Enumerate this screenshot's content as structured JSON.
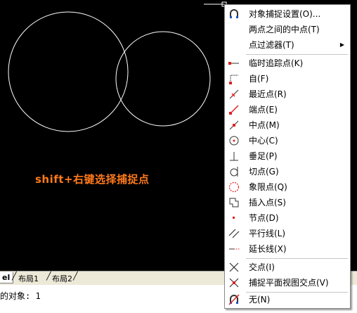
{
  "canvas": {
    "caption": "shift+右键选择捕捉点"
  },
  "tabs": [
    {
      "label": "el"
    },
    {
      "label": "布局1"
    },
    {
      "label": "布局2"
    }
  ],
  "command_line": "的对象: 1",
  "menu": {
    "items": [
      {
        "label": "对象捕捉设置(O)...",
        "icon": "snap-settings-icon"
      },
      {
        "label": "两点之间的中点(T)",
        "icon": ""
      },
      {
        "label": "点过滤器(T)",
        "icon": "",
        "submenu": "▶"
      },
      {
        "label": "临时追踪点(K)",
        "icon": "temporary-track-icon"
      },
      {
        "label": "自(F)",
        "icon": "from-icon"
      },
      {
        "label": "最近点(R)",
        "icon": "nearest-icon"
      },
      {
        "label": "端点(E)",
        "icon": "endpoint-icon"
      },
      {
        "label": "中点(M)",
        "icon": "midpoint-icon"
      },
      {
        "label": "中心(C)",
        "icon": "center-icon"
      },
      {
        "label": "垂足(P)",
        "icon": "perpendicular-icon"
      },
      {
        "label": "切点(G)",
        "icon": "tangent-icon"
      },
      {
        "label": "象限点(Q)",
        "icon": "quadrant-icon"
      },
      {
        "label": "插入点(S)",
        "icon": "insertion-icon"
      },
      {
        "label": "节点(D)",
        "icon": "node-icon"
      },
      {
        "label": "平行线(L)",
        "icon": "parallel-icon"
      },
      {
        "label": "延长线(X)",
        "icon": "extension-icon"
      },
      {
        "label": "交点(I)",
        "icon": "intersection-icon"
      },
      {
        "label": "捕捉平面视图交点(V)",
        "icon": "apparent-intersection-icon"
      },
      {
        "label": "无(N)",
        "icon": "none-icon"
      }
    ]
  },
  "colors": {
    "caption": "#ff7a1c",
    "icon_red": "#e02020",
    "circle": "#ffffff"
  }
}
